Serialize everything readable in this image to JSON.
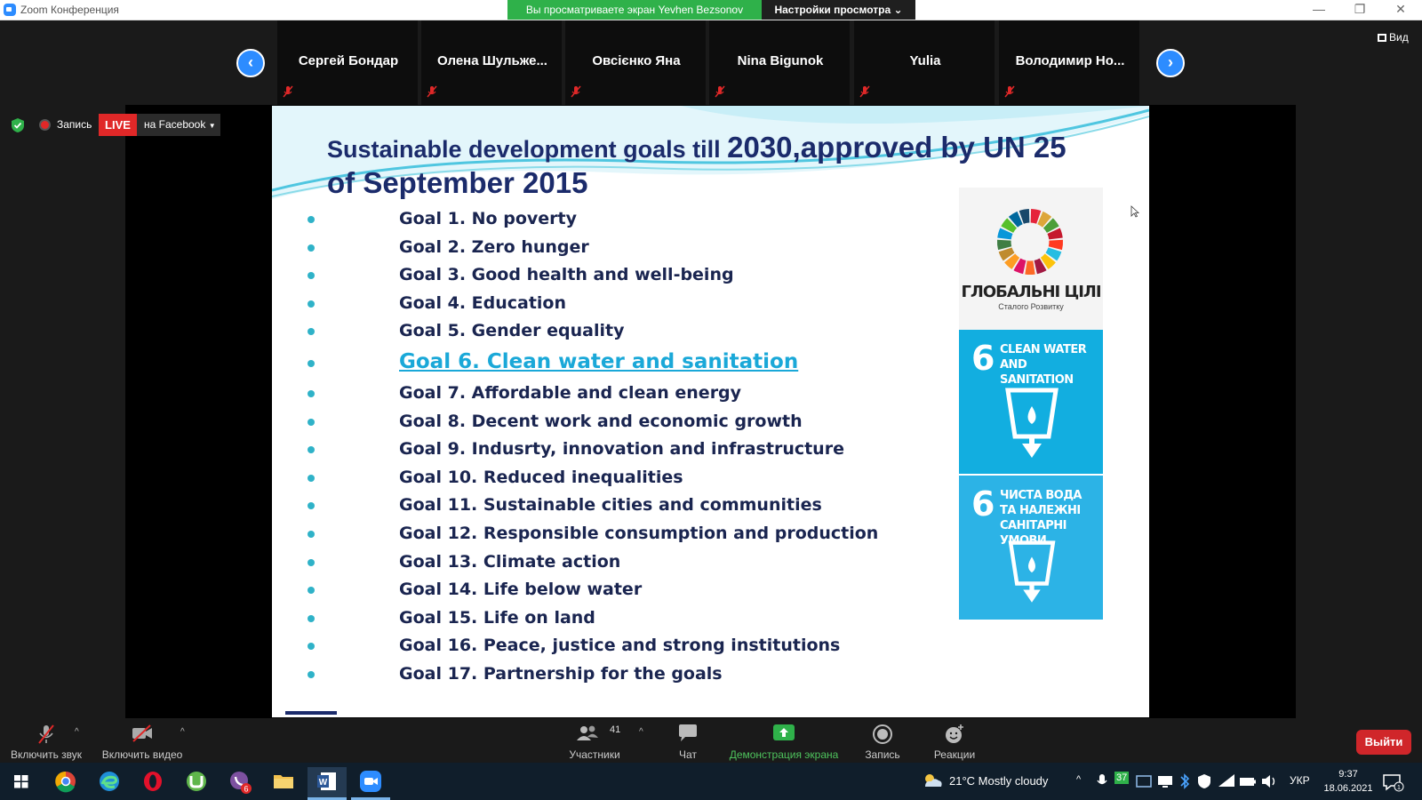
{
  "window": {
    "title": "Zoom Конференция",
    "share_banner": "Вы просматриваете экран Yevhen Bezsonov",
    "view_options": "Настройки просмотра ⌄"
  },
  "gallery": {
    "view_label": "Вид",
    "participants": [
      {
        "name": "Сергей Бондар"
      },
      {
        "name": "Олена  Шульже..."
      },
      {
        "name": "Овсієнко Яна"
      },
      {
        "name": "Nina Bigunok"
      },
      {
        "name": "Yulia"
      },
      {
        "name": "Володимир  Но..."
      }
    ]
  },
  "status": {
    "recording_label": "Запись",
    "live_badge": "LIVE",
    "live_target": "на Facebook"
  },
  "slide": {
    "title_part1": "Sustainable development goals till ",
    "title_part2": "2030,approved by UN 25",
    "title_line2": "of September 2015",
    "goals": [
      "Goal 1. No poverty",
      "Goal 2. Zero hunger",
      "Goal 3. Good health and well-being",
      "Goal 4. Education",
      "Goal 5. Gender equality",
      "Goal 6. Clean water and sanitation",
      "Goal 7. Affordable and clean energy",
      "Goal 8. Decent work and economic growth",
      "Goal 9. Indusrty, innovation and infrastructure",
      "Goal 10. Reduced inequalities",
      "Goal 11. Sustainable cities and communities",
      "Goal 12. Responsible consumption and production",
      "Goal 13. Climate action",
      "Goal 14. Life below water",
      "Goal 15. Life on land",
      "Goal 16. Peace, justice and strong institutions",
      "Goal 17. Partnership for the goals"
    ],
    "highlighted_goal_index": 5,
    "sdg_logo_title": "ГЛОБАЛЬНІ ЦІЛІ",
    "sdg_logo_subtitle": "Сталого Розвитку",
    "sdg_card_en_number": "6",
    "sdg_card_en_label": "CLEAN WATER AND SANITATION",
    "sdg_card_ua_number": "6",
    "sdg_card_ua_label": "ЧИСТА ВОДА ТА НАЛЕЖНІ САНІТАРНІ УМОВИ"
  },
  "toolbar": {
    "mute_label": "Включить звук",
    "video_label": "Включить видео",
    "participants_label": "Участники",
    "participants_count": "41",
    "chat_label": "Чат",
    "share_label": "Демонстрация экрана",
    "record_label": "Запись",
    "reactions_label": "Реакции",
    "leave_label": "Выйти"
  },
  "taskbar": {
    "weather": "21°C  Mostly cloudy",
    "language": "УКР",
    "time": "9:37",
    "date": "18.06.2021",
    "viber_badge": "6",
    "tray_badge": "37"
  },
  "colors": {
    "accent_blue": "#2d8cff",
    "share_green": "#2fb14a",
    "live_red": "#e02828",
    "slide_title": "#1b2b6b",
    "goal_highlight": "#1aa8d8",
    "sdg6_blue": "#12aee0"
  }
}
